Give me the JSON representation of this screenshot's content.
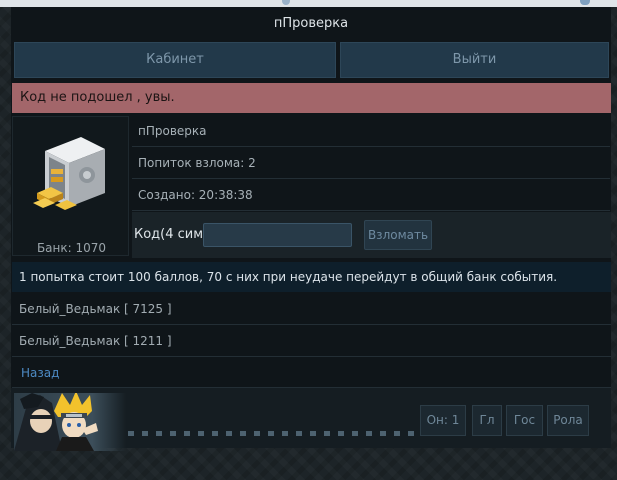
{
  "header": {
    "title": "пПроверка"
  },
  "nav": {
    "cabinet_label": "Кабинет",
    "logout_label": "Выйти"
  },
  "alert": {
    "message": "Код не подошел , увы."
  },
  "safe": {
    "bank_label": "Банк: 1070",
    "icon": "safe-with-gold-icon"
  },
  "info": {
    "name": "пПроверка",
    "attempts": "Попиток взлома: 2",
    "created": "Создано: 20:38:38"
  },
  "code_form": {
    "label": "Код(4 сим)",
    "input_value": "",
    "submit_label": "Взломать"
  },
  "note": "1 попытка стоит 100 баллов, 70 с них при неудаче перейдут в общий банк события.",
  "entries": [
    {
      "text": "Белый_Ведьмак [ 7125 ]"
    },
    {
      "text": "Белый_Ведьмак [ 1211 ]"
    }
  ],
  "back_link": "Назад",
  "footer": {
    "buttons": [
      {
        "label": "Он: 1"
      },
      {
        "label": "Гл"
      },
      {
        "label": "Гос"
      },
      {
        "label": "Рола"
      }
    ]
  },
  "colors": {
    "background": "#1d2428",
    "panel": "#0f1519",
    "alert": "#a3666a",
    "link": "#4d8ac4",
    "button": "#22394a"
  }
}
